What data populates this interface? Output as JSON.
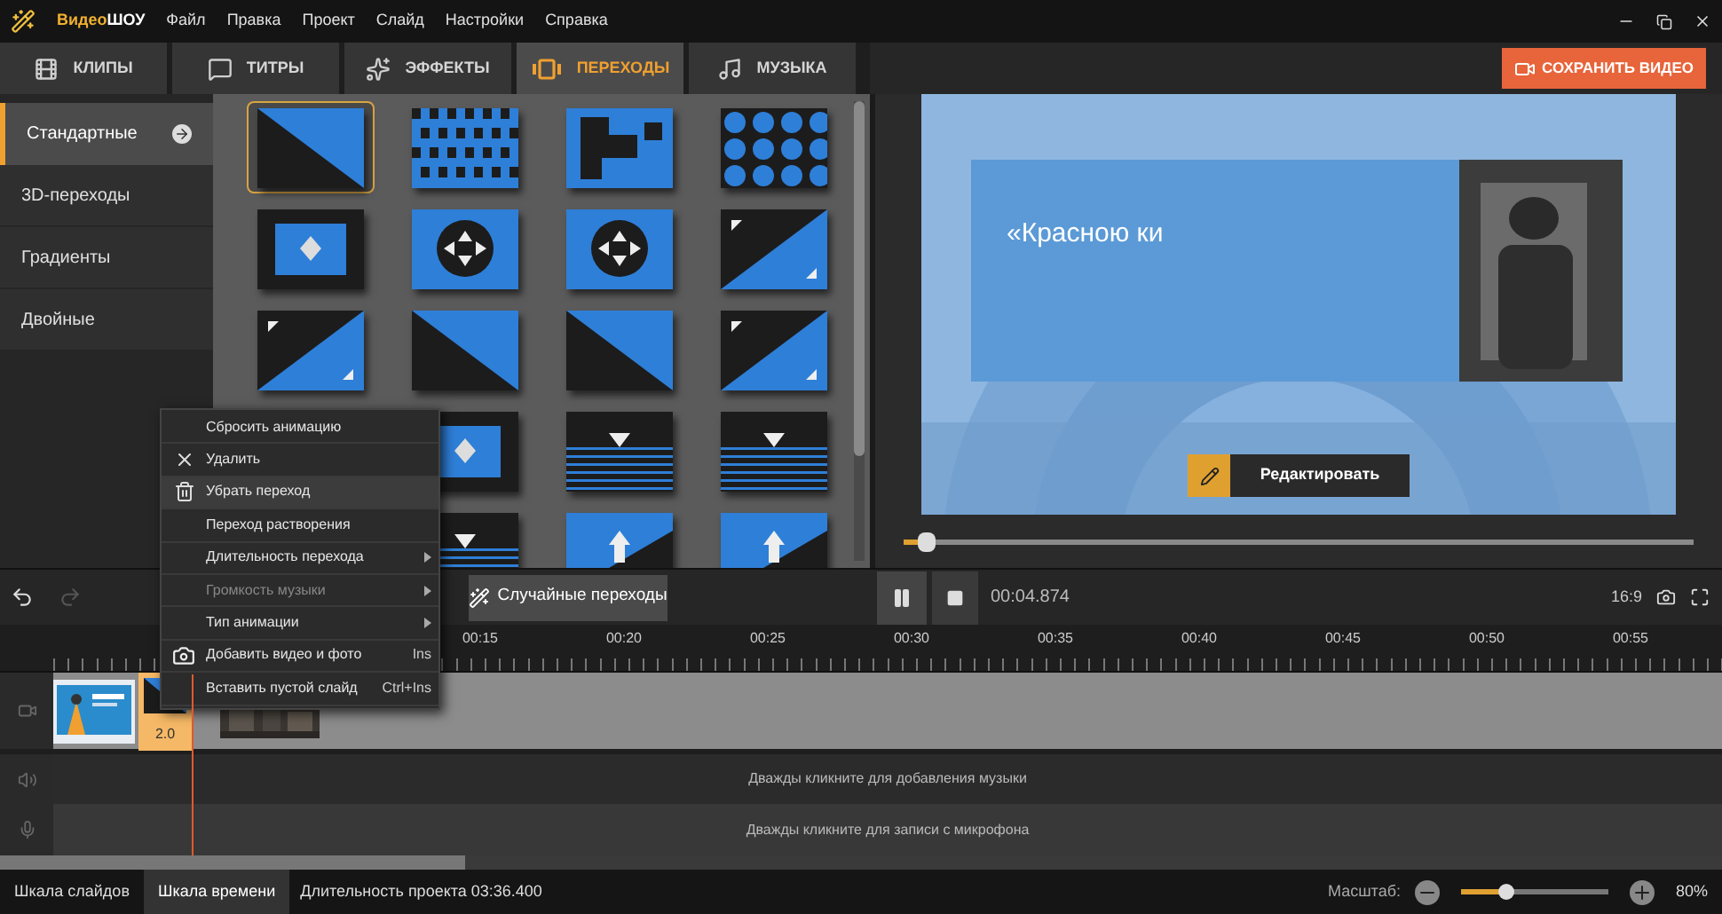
{
  "app": {
    "name_part1": "Видео",
    "name_part2": "ШОУ"
  },
  "menu": [
    "Файл",
    "Правка",
    "Проект",
    "Слайд",
    "Настройки",
    "Справка"
  ],
  "tabs": [
    {
      "label": "КЛИПЫ",
      "kind": "clips",
      "selected": false
    },
    {
      "label": "ТИТРЫ",
      "kind": "titles",
      "selected": false
    },
    {
      "label": "ЭФФЕКТЫ",
      "kind": "effects",
      "selected": false
    },
    {
      "label": "ПЕРЕХОДЫ",
      "kind": "transitions",
      "selected": true
    },
    {
      "label": "МУЗЫКА",
      "kind": "music",
      "selected": false
    }
  ],
  "save_button": "СОХРАНИТЬ ВИДЕО",
  "categories": [
    {
      "label": "Стандартные",
      "selected": true
    },
    {
      "label": "3D-переходы",
      "selected": false
    },
    {
      "label": "Градиенты",
      "selected": false
    },
    {
      "label": "Двойные",
      "selected": false
    }
  ],
  "transition_rows": [
    [
      {
        "kind": "diagonal",
        "selected": true
      },
      {
        "kind": "checker",
        "selected": false
      },
      {
        "kind": "blocks",
        "selected": false
      },
      {
        "kind": "hex",
        "selected": false
      }
    ],
    [
      {
        "kind": "center",
        "selected": false
      },
      {
        "kind": "circle",
        "selected": false
      },
      {
        "kind": "circle",
        "selected": false
      },
      {
        "kind": "corner",
        "selected": false
      }
    ],
    [
      {
        "kind": "corner",
        "selected": false
      },
      {
        "kind": "diagonal",
        "selected": false
      },
      {
        "kind": "diagonal",
        "selected": false
      },
      {
        "kind": "corner",
        "selected": false
      }
    ],
    [
      {
        "kind": "center",
        "selected": false
      },
      {
        "kind": "stripes",
        "selected": false
      },
      {
        "kind": "stripes",
        "selected": false
      }
    ],
    [
      {
        "kind": "stripes",
        "selected": false
      },
      {
        "kind": "arrow",
        "selected": false
      },
      {
        "kind": "arrow",
        "selected": false
      }
    ]
  ],
  "preview": {
    "slide_text": "«Красною ки",
    "edit_button": "Редактировать",
    "level": 0.02
  },
  "toolbar": {
    "random_button": "Случайные переходы",
    "time": "00:04.874",
    "aspect": "16:9"
  },
  "context_menu": [
    {
      "label": "Сбросить анимацию",
      "kind": "plain",
      "selected": false,
      "disabled": false,
      "submenu": false
    },
    {
      "label": "Удалить",
      "kind": "delete",
      "selected": false,
      "disabled": false,
      "submenu": false
    },
    {
      "label": "Убрать переход",
      "kind": "remove",
      "selected": true,
      "disabled": false,
      "submenu": false
    },
    {
      "label": "Переход растворения",
      "kind": "plain",
      "selected": false,
      "disabled": false,
      "submenu": false
    },
    {
      "label": "Длительность перехода",
      "kind": "plain",
      "selected": false,
      "disabled": false,
      "submenu": true
    },
    {
      "label": "Громкость музыки",
      "kind": "plain",
      "selected": false,
      "disabled": true,
      "submenu": true
    },
    {
      "label": "Тип анимации",
      "kind": "plain",
      "selected": false,
      "disabled": false,
      "submenu": true
    },
    {
      "label": "Добавить видео и фото",
      "kind": "add",
      "shortcut": "Ins",
      "selected": false,
      "disabled": false,
      "submenu": false
    },
    {
      "label": "Вставить пустой слайд",
      "kind": "plain",
      "shortcut": "Ctrl+Ins",
      "selected": false,
      "disabled": false,
      "submenu": false
    }
  ],
  "timeline": {
    "ruler": [
      "00:15",
      "00:20",
      "00:25",
      "00:30",
      "00:35",
      "00:40",
      "00:45",
      "00:50",
      "00:55"
    ],
    "clips": [
      {
        "kind": "slide"
      },
      {
        "kind": "transition",
        "label": "2.0"
      },
      {
        "kind": "video"
      }
    ],
    "music_hint": "Дважды кликните для добавления музыки",
    "mic_hint": "Дважды кликните для записи с микрофона"
  },
  "status_bar": {
    "views": [
      {
        "label": "Шкала слайдов",
        "selected": false
      },
      {
        "label": "Шкала времени",
        "selected": true
      }
    ],
    "duration": "Длительность проекта 03:36.400",
    "zoom_label": "Масштаб:",
    "zoom": {
      "level": 0.3
    },
    "zoom_value": "80%"
  }
}
